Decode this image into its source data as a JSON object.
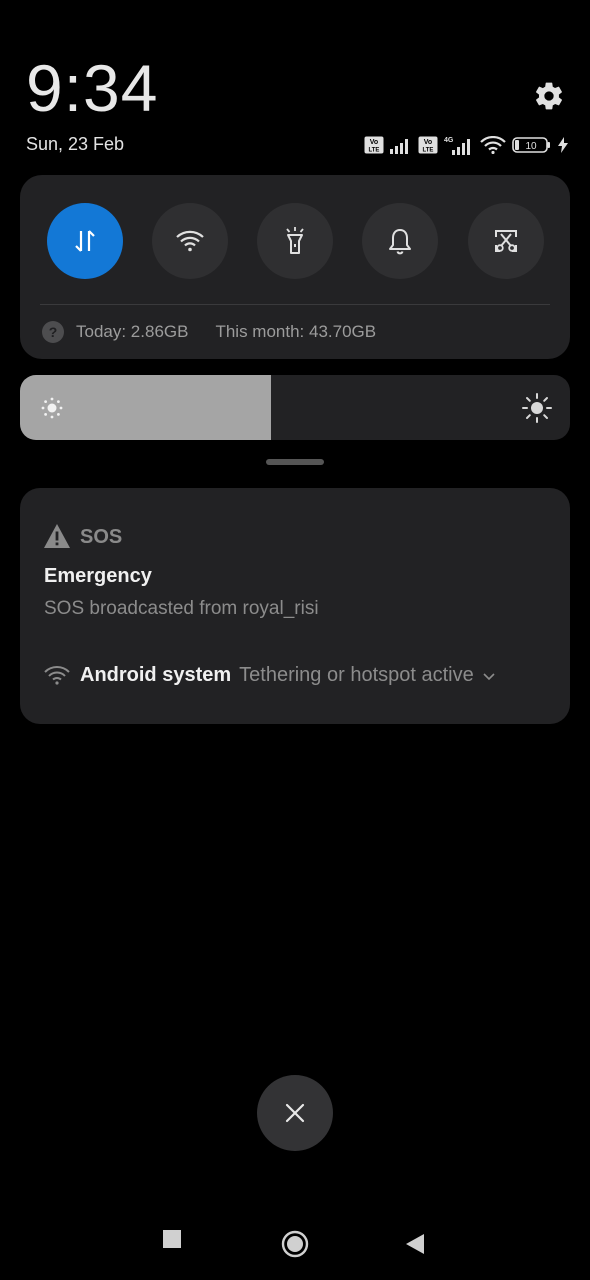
{
  "status": {
    "time": "9:34",
    "date": "Sun, 23 Feb",
    "sim1_label": "Vo LTE",
    "sim2_label": "Vo LTE",
    "network_label": "4G",
    "battery": "10"
  },
  "quick_settings": {
    "tiles": [
      {
        "name": "mobile-data",
        "icon": "data-transfer-icon",
        "active": true
      },
      {
        "name": "wifi",
        "icon": "wifi-icon",
        "active": false
      },
      {
        "name": "flashlight",
        "icon": "flashlight-icon",
        "active": false
      },
      {
        "name": "sound",
        "icon": "bell-icon",
        "active": false
      },
      {
        "name": "screenshot",
        "icon": "scissors-screenshot-icon",
        "active": false
      }
    ],
    "data_today": "Today: 2.86GB",
    "data_month": "This month: 43.70GB",
    "accent_color": "#1378d6"
  },
  "brightness": {
    "level": 0.457
  },
  "notification": {
    "app": "SOS",
    "title": "Emergency",
    "body": "SOS broadcasted from royal_risi",
    "system_name": "Android system",
    "system_text": "Tethering or hotspot active"
  },
  "nav": {
    "icons": [
      "recents-square-icon",
      "home-circle-icon",
      "back-triangle-icon"
    ]
  }
}
